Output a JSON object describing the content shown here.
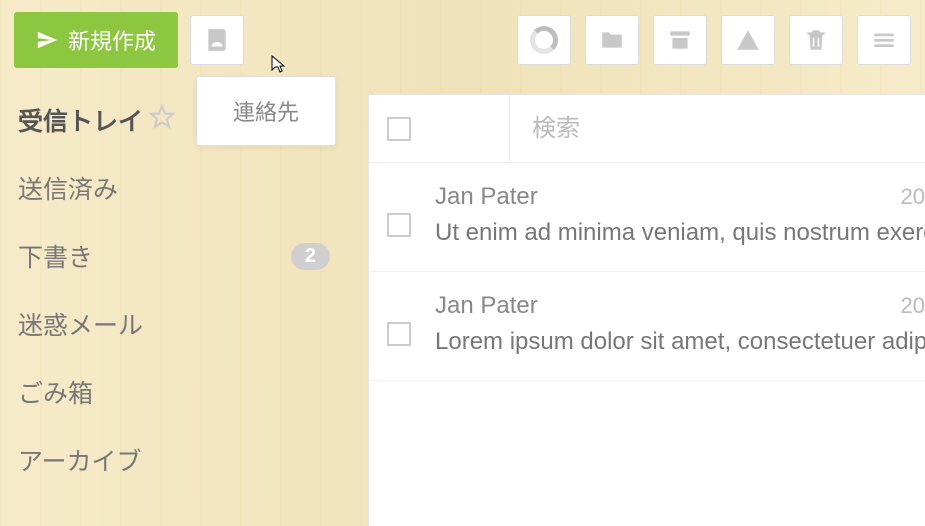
{
  "compose": {
    "label": "新規作成"
  },
  "tooltip": {
    "text": "連絡先"
  },
  "sidebar": {
    "folders": [
      {
        "label": "受信トレイ",
        "active": true,
        "starred": true
      },
      {
        "label": "送信済み"
      },
      {
        "label": "下書き",
        "badge": "2"
      },
      {
        "label": "迷惑メール"
      },
      {
        "label": "ごみ箱"
      },
      {
        "label": "アーカイブ"
      }
    ]
  },
  "search": {
    "placeholder": "検索"
  },
  "messages": [
    {
      "sender": "Jan Pater",
      "date": "20",
      "preview": "Ut enim ad minima veniam, quis nostrum exercita"
    },
    {
      "sender": "Jan Pater",
      "date": "20",
      "preview": "Lorem ipsum dolor sit amet, consectetuer adipisc"
    }
  ]
}
